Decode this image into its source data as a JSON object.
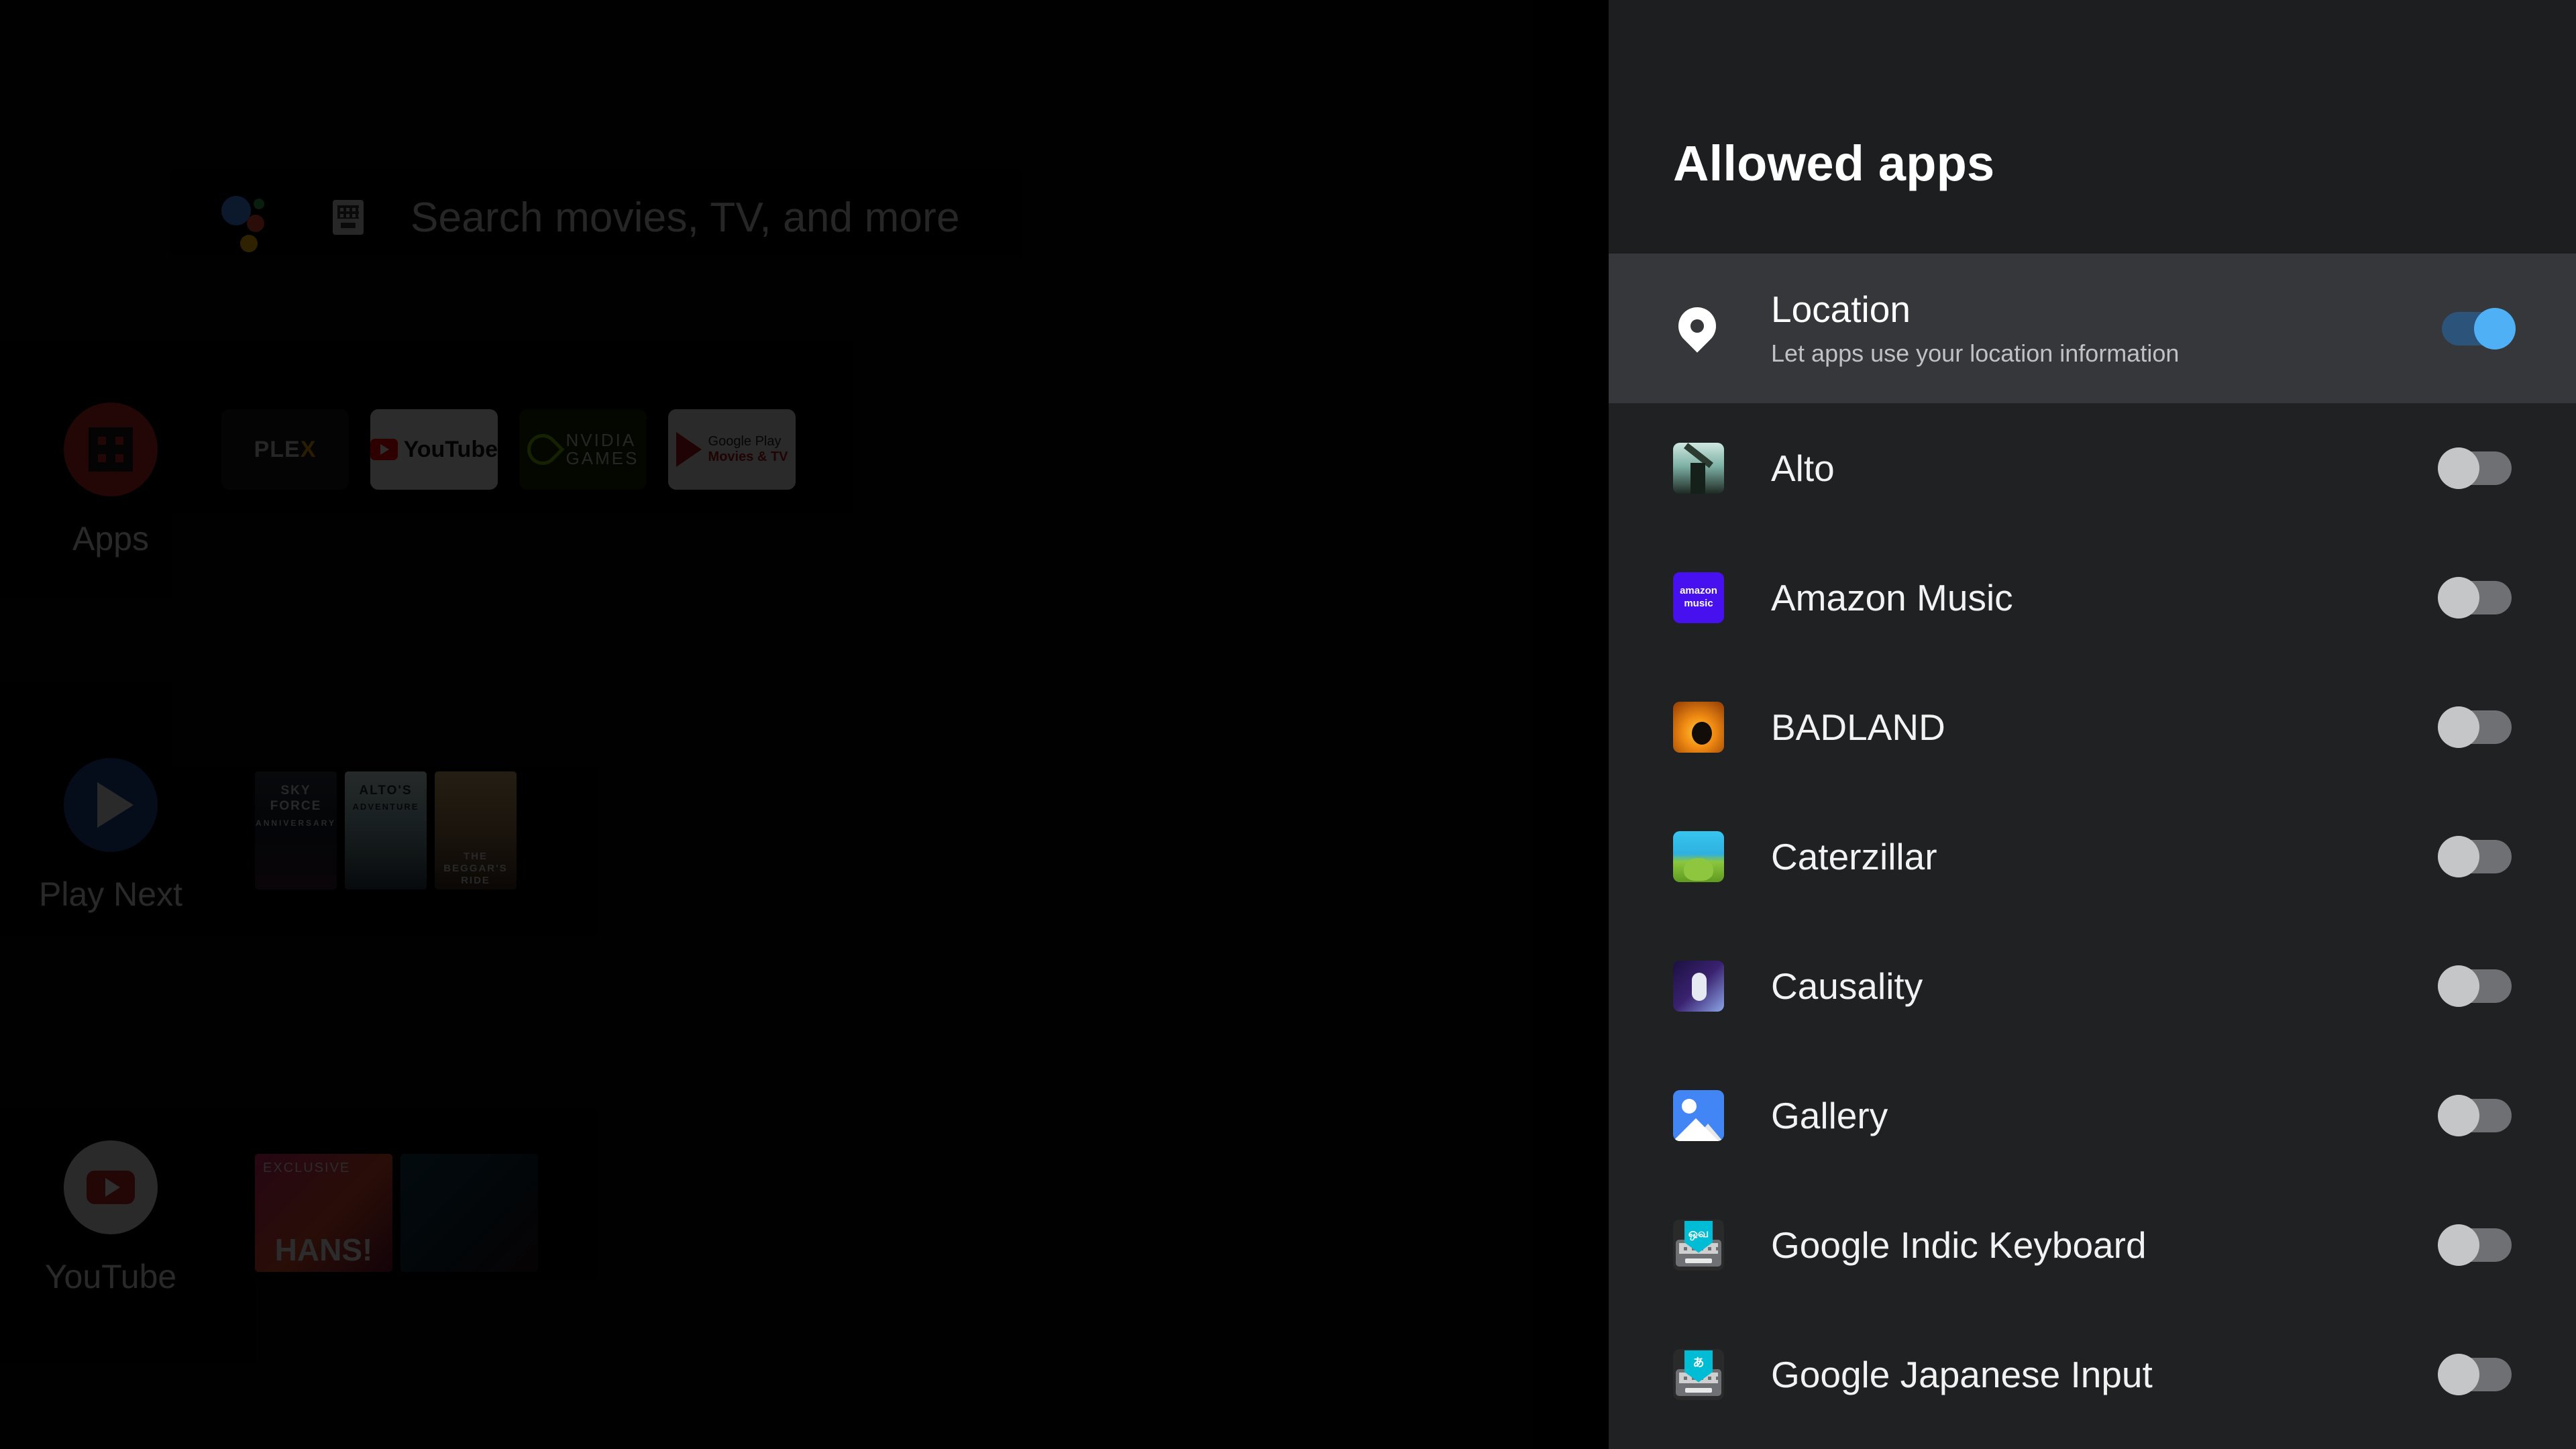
{
  "background": {
    "search": {
      "placeholder": "Search movies, TV, and more",
      "assistant_icon": "google-assistant-dots",
      "keyboard_icon": "keyboard-icon"
    },
    "rows": [
      {
        "label": "Apps",
        "icon": "apps-grid-icon",
        "tiles": [
          {
            "name": "PLEX",
            "name_part1": "PLE",
            "name_part2": "X"
          },
          {
            "name": "YouTube"
          },
          {
            "name": "NVIDIA GAMES",
            "line1": "NVIDIA",
            "line2": "GAMES"
          },
          {
            "name": "Google Play Movies & TV",
            "line1": "Google Play",
            "line2": "Movies & TV"
          }
        ]
      },
      {
        "label": "Play Next",
        "icon": "play-triangle-icon",
        "cards": [
          {
            "title": "SKY FORCE",
            "subtitle": "ANNIVERSARY"
          },
          {
            "title": "ALTO'S",
            "subtitle": "ADVENTURE"
          },
          {
            "title": "THE BEGGAR'S",
            "subtitle": "RIDE"
          }
        ]
      },
      {
        "label": "YouTube",
        "icon": "youtube-play-icon",
        "wide_cards": [
          {
            "tag": "EXCLUSIVE",
            "title": "HANS!"
          },
          {
            "tag": "",
            "title": ""
          }
        ]
      }
    ]
  },
  "panel": {
    "title": "Allowed apps",
    "location": {
      "icon": "location-pin-icon",
      "title": "Location",
      "subtitle": "Let apps use your location information",
      "toggle_state": "on",
      "selected": true
    },
    "toggle_on_color": "#4FB0F5",
    "toggle_off_color": "#C4C6C7",
    "apps": [
      {
        "name": "Alto",
        "icon": "alto-app-icon",
        "toggle_state": "off"
      },
      {
        "name": "Amazon Music",
        "icon": "amazon-music-app-icon",
        "toggle_state": "off",
        "icon_text_line1": "amazon",
        "icon_text_line2": "music"
      },
      {
        "name": "BADLAND",
        "icon": "badland-app-icon",
        "toggle_state": "off"
      },
      {
        "name": "Caterzillar",
        "icon": "caterzillar-app-icon",
        "toggle_state": "off"
      },
      {
        "name": "Causality",
        "icon": "causality-app-icon",
        "toggle_state": "off"
      },
      {
        "name": "Gallery",
        "icon": "gallery-app-icon",
        "toggle_state": "off"
      },
      {
        "name": "Google Indic Keyboard",
        "icon": "indic-keyboard-app-icon",
        "toggle_state": "off",
        "icon_badge_text": "ஒவ"
      },
      {
        "name": "Google Japanese Input",
        "icon": "japanese-input-app-icon",
        "toggle_state": "off",
        "icon_badge_text": "あ"
      }
    ]
  }
}
